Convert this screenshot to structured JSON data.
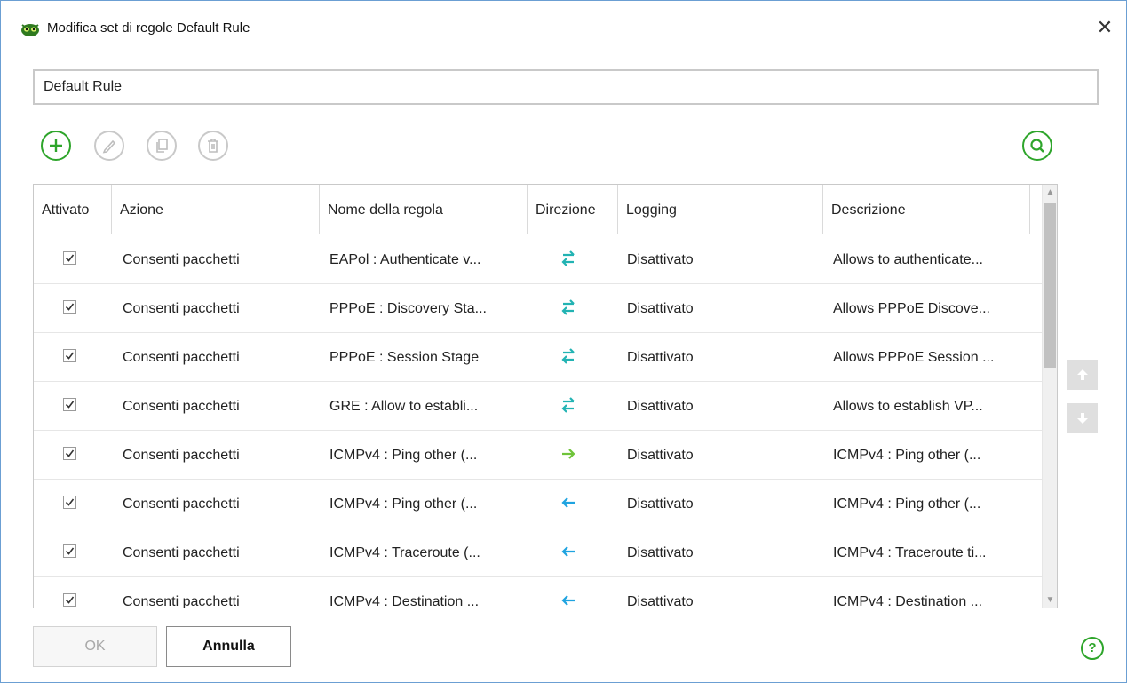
{
  "window": {
    "title": "Modifica set di regole Default Rule",
    "close_glyph": "✕"
  },
  "rule_set_name": {
    "value": "Default Rule"
  },
  "toolbar": {
    "icons": [
      "add-icon",
      "edit-icon",
      "copy-icon",
      "delete-icon",
      "search-icon"
    ]
  },
  "table": {
    "columns": [
      "Attivato",
      "Azione",
      "Nome della regola",
      "Direzione",
      "Logging",
      "Descrizione"
    ],
    "rows": [
      {
        "enabled": true,
        "action": "Consenti pacchetti",
        "name": "EAPol : Authenticate v...",
        "direction": "bidirectional",
        "logging": "Disattivato",
        "description": "Allows to authenticate..."
      },
      {
        "enabled": true,
        "action": "Consenti pacchetti",
        "name": "PPPoE : Discovery Sta...",
        "direction": "bidirectional",
        "logging": "Disattivato",
        "description": "Allows PPPoE Discove..."
      },
      {
        "enabled": true,
        "action": "Consenti pacchetti",
        "name": "PPPoE : Session Stage",
        "direction": "bidirectional",
        "logging": "Disattivato",
        "description": "Allows PPPoE Session ..."
      },
      {
        "enabled": true,
        "action": "Consenti pacchetti",
        "name": "GRE : Allow to establi...",
        "direction": "bidirectional",
        "logging": "Disattivato",
        "description": "Allows to establish VP..."
      },
      {
        "enabled": true,
        "action": "Consenti pacchetti",
        "name": "ICMPv4 : Ping other (...",
        "direction": "outgoing",
        "logging": "Disattivato",
        "description": "ICMPv4 : Ping other (..."
      },
      {
        "enabled": true,
        "action": "Consenti pacchetti",
        "name": "ICMPv4 : Ping other (...",
        "direction": "incoming",
        "logging": "Disattivato",
        "description": "ICMPv4 : Ping other (..."
      },
      {
        "enabled": true,
        "action": "Consenti pacchetti",
        "name": "ICMPv4 : Traceroute (...",
        "direction": "incoming",
        "logging": "Disattivato",
        "description": "ICMPv4 : Traceroute ti..."
      },
      {
        "enabled": true,
        "action": "Consenti pacchetti",
        "name": "ICMPv4 : Destination ...",
        "direction": "incoming",
        "logging": "Disattivato",
        "description": "ICMPv4 : Destination ..."
      }
    ]
  },
  "buttons": {
    "ok": "OK",
    "cancel": "Annulla",
    "help": "?"
  },
  "colors": {
    "accent_green": "#2ea52b",
    "arrow_teal": "#22b3b3",
    "arrow_green": "#6fc43a",
    "arrow_blue": "#1fa3e0"
  }
}
